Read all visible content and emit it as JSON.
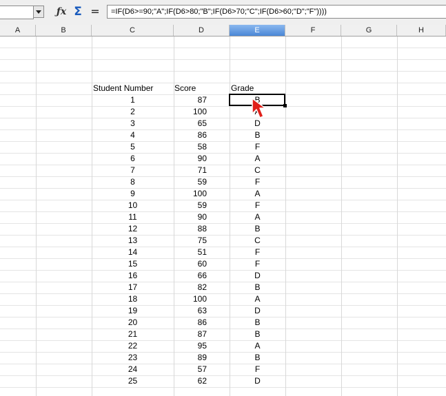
{
  "formula_bar": {
    "name_box_value": "",
    "function_wizard_icon": "fx-icon",
    "sum_icon": "sigma-icon",
    "equals_icon": "equals-icon",
    "formula": "=IF(D6>=90;\"A\";IF(D6>80;\"B\";IF(D6>70;\"C\";IF(D6>60;\"D\";\"F\"))))"
  },
  "columns": [
    "A",
    "B",
    "C",
    "D",
    "E",
    "F",
    "G",
    "H"
  ],
  "selected_column": "E",
  "table": {
    "headers": [
      "Student Number",
      "Score",
      "Grade"
    ],
    "rows": [
      [
        "1",
        "87",
        "B"
      ],
      [
        "2",
        "100",
        "A"
      ],
      [
        "3",
        "65",
        "D"
      ],
      [
        "4",
        "86",
        "B"
      ],
      [
        "5",
        "58",
        "F"
      ],
      [
        "6",
        "90",
        "A"
      ],
      [
        "7",
        "71",
        "C"
      ],
      [
        "8",
        "59",
        "F"
      ],
      [
        "9",
        "100",
        "A"
      ],
      [
        "10",
        "59",
        "F"
      ],
      [
        "11",
        "90",
        "A"
      ],
      [
        "12",
        "88",
        "B"
      ],
      [
        "13",
        "75",
        "C"
      ],
      [
        "14",
        "51",
        "F"
      ],
      [
        "15",
        "60",
        "F"
      ],
      [
        "16",
        "66",
        "D"
      ],
      [
        "17",
        "82",
        "B"
      ],
      [
        "18",
        "100",
        "A"
      ],
      [
        "19",
        "63",
        "D"
      ],
      [
        "20",
        "86",
        "B"
      ],
      [
        "21",
        "87",
        "B"
      ],
      [
        "22",
        "95",
        "A"
      ],
      [
        "23",
        "89",
        "B"
      ],
      [
        "24",
        "57",
        "F"
      ],
      [
        "25",
        "62",
        "D"
      ]
    ]
  },
  "colors": {
    "selected_column_header": "#4a86d6",
    "mouse_pointer": "#e0201a"
  }
}
